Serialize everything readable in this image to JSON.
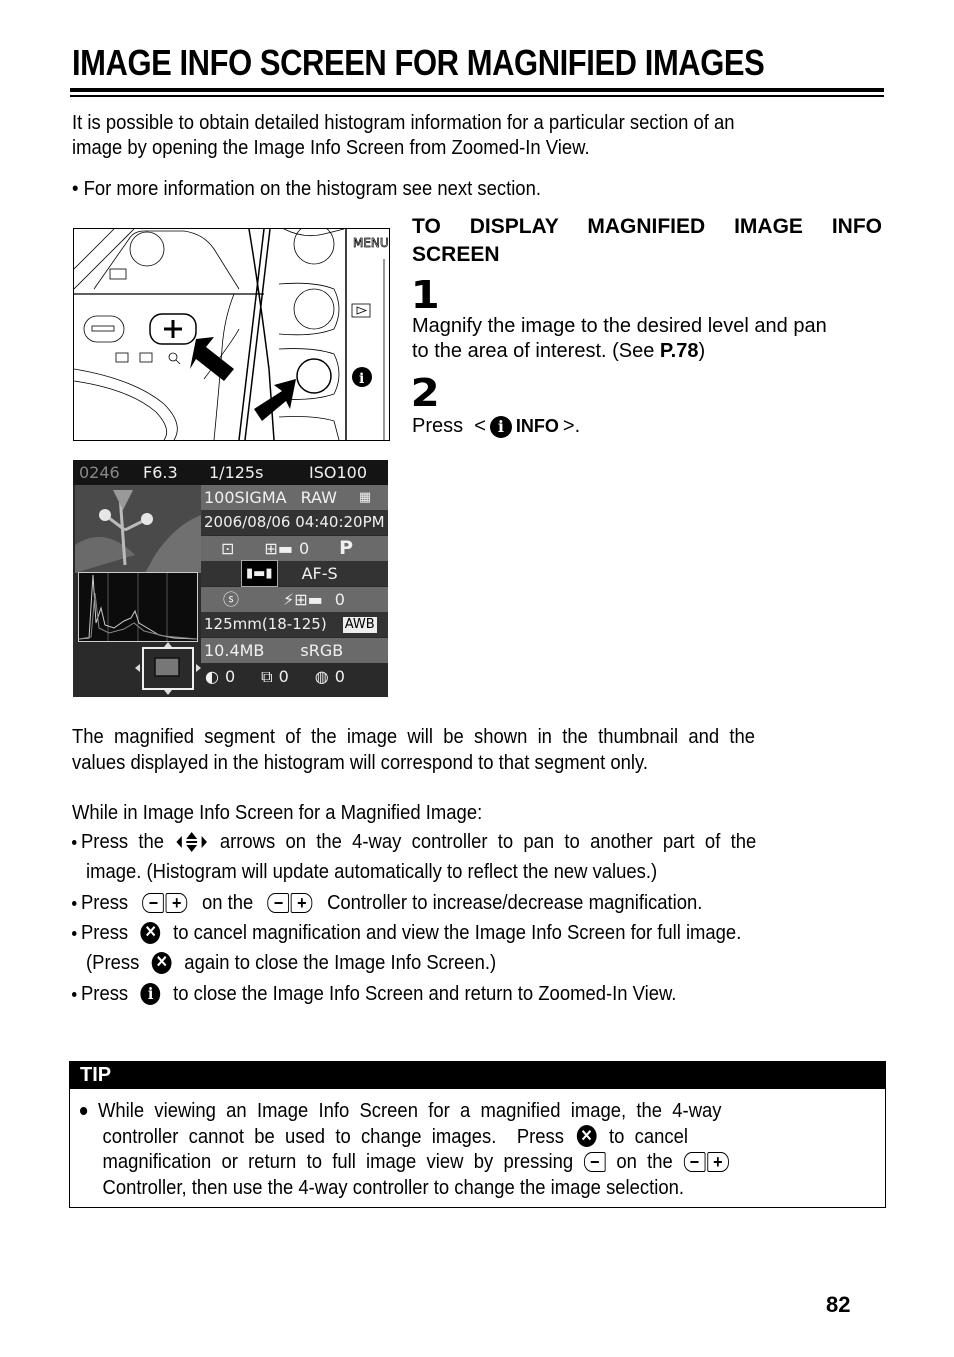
{
  "page": {
    "title": "IMAGE INFO SCREEN FOR MAGNIFIED IMAGES",
    "intro_line1": "It is possible to obtain detailed histogram information for a particular section of an",
    "intro_line2": "image by opening the Image Info Screen from Zoomed-In View.",
    "intro_note": "• For more information on the histogram see next section.",
    "page_number": "82"
  },
  "steps": {
    "heading_line1": "TO  DISPLAY  MAGNIFIED  IMAGE  INFO",
    "heading_line2": "SCREEN",
    "step1_number": "1",
    "step1_line1": "Magnify the image to the desired level and pan",
    "step1_line2_pre": "to the area of interest. (See ",
    "step1_ref": "P.78",
    "step1_line2_post": ")",
    "step2_number": "2",
    "step2_pre": "Press  <",
    "step2_button": "INFO",
    "step2_post": ">."
  },
  "camera_illustration": {
    "menu_label": "MENU",
    "plus_label": "+",
    "minus_label": "−",
    "info_icon": "i"
  },
  "lcd": {
    "frame_number": "0246",
    "aperture": "F6.3",
    "shutter": "1/125s",
    "iso": "ISO100",
    "folder": "100SIGMA",
    "format": "RAW",
    "datetime": "2006/08/06 04:40:20PM",
    "exposure_comp": "0",
    "mode": "P",
    "af_mode": "AF-S",
    "flash_comp": "0",
    "focal_length": "125mm(18-125)",
    "white_balance": "AWB",
    "file_size": "10.4MB",
    "color_space": "sRGB",
    "contrast": "0",
    "sharpness": "0",
    "saturation": "0"
  },
  "body": {
    "para1_line1": "The  magnified  segment  of  the  image  will  be  shown  in  the  thumbnail  and  the",
    "para1_line2": "values displayed in the histogram will correspond to that segment only.",
    "para2": "While in Image Info Screen for a Magnified Image:",
    "bullets": [
      {
        "pre": "Press  the",
        "post": "arrows  on  the  4-way  controller  to  pan  to  another  part  of  the"
      },
      {
        "cont": "image. (Histogram will update automatically to reflect the new values.)"
      },
      {
        "pre": "Press",
        "mid": "on the",
        "post": "Controller to increase/decrease magnification."
      },
      {
        "pre": "Press",
        "post": "to cancel magnification and view the Image Info Screen for full image."
      },
      {
        "pre": "(Press",
        "post": "again to close the Image Info Screen.)"
      },
      {
        "pre": "Press",
        "post": "to close the Image Info Screen and return to Zoomed-In View."
      }
    ]
  },
  "tip": {
    "label": "TIP",
    "line1": "While  viewing  an  Image  Info  Screen  for  a  magnified  image,  the  4-way",
    "line2_pre": "controller  cannot  be  used  to  change  images.    Press",
    "line2_post": "to  cancel",
    "line3_pre": "magnification  or  return  to  full  image  view  by  pressing",
    "line3_mid": "on  the",
    "line4": "Controller, then use the 4-way controller to change the image selection."
  }
}
